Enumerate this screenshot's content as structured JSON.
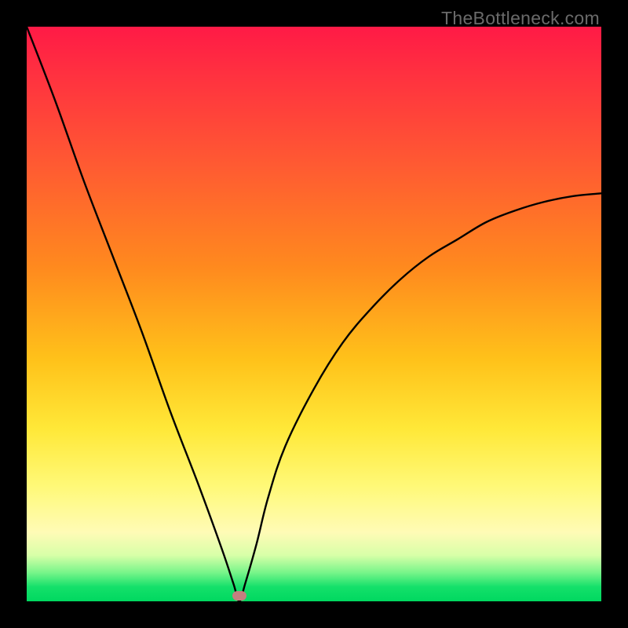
{
  "watermark": "TheBottleneck.com",
  "chart_data": {
    "type": "line",
    "title": "",
    "xlabel": "",
    "ylabel": "",
    "x_range": [
      0,
      100
    ],
    "y_range": [
      0,
      100
    ],
    "grid": false,
    "gradient_stops": [
      {
        "pos": 0,
        "color": "#ff1a46"
      },
      {
        "pos": 0.24,
        "color": "#ff5a32"
      },
      {
        "pos": 0.58,
        "color": "#ffc21a"
      },
      {
        "pos": 0.8,
        "color": "#fff978"
      },
      {
        "pos": 0.95,
        "color": "#78f58a"
      },
      {
        "pos": 1.0,
        "color": "#00d860"
      }
    ],
    "series": [
      {
        "name": "bottleneck_curve",
        "note": "V-shaped curve; y is distance-from-optimum (0 = green/bottom, 100 = red/top). Minimum at x≈37.",
        "x": [
          0,
          5,
          10,
          15,
          20,
          25,
          30,
          34,
          36,
          37,
          38,
          40,
          42,
          45,
          50,
          55,
          60,
          65,
          70,
          75,
          80,
          85,
          90,
          95,
          100
        ],
        "y": [
          100,
          87,
          73,
          60,
          47,
          33,
          20,
          9,
          3,
          0,
          3,
          10,
          18,
          27,
          37,
          45,
          51,
          56,
          60,
          63,
          66,
          68,
          69.5,
          70.5,
          71
        ]
      }
    ],
    "marker": {
      "x": 37,
      "y": 1,
      "color": "#c47f7f"
    }
  }
}
